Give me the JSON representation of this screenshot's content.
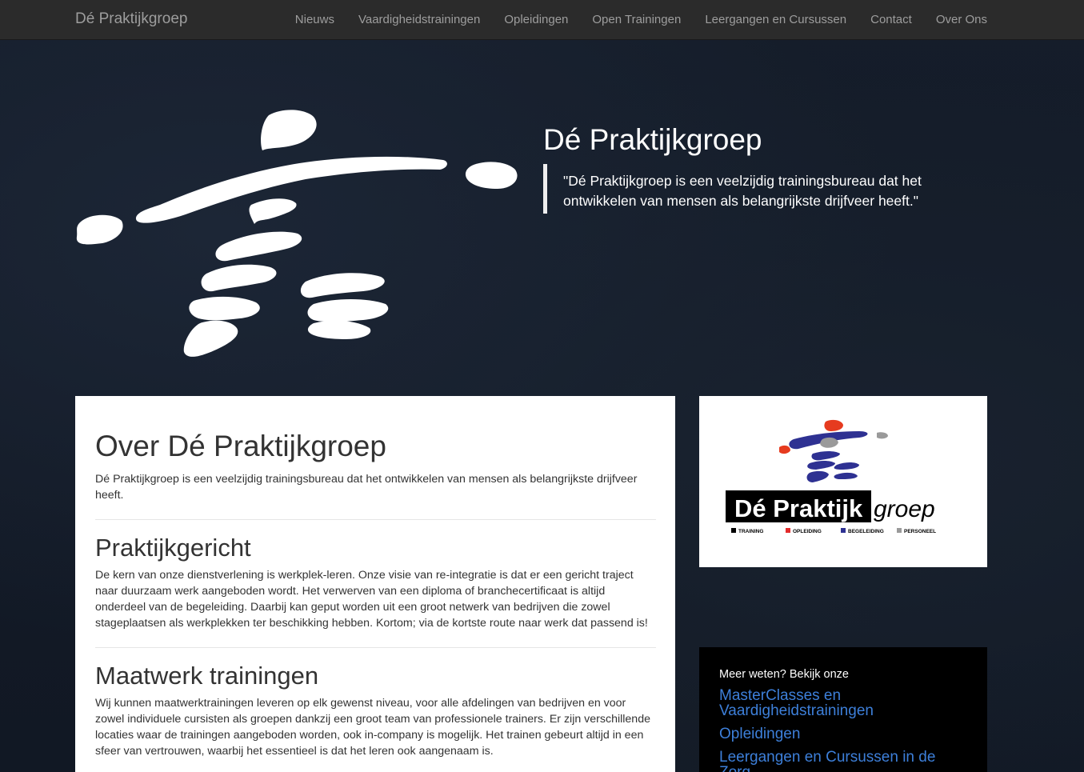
{
  "navbar": {
    "brand": "Dé Praktijkgroep",
    "items": [
      "Nieuws",
      "Vaardigheidstrainingen",
      "Opleidingen",
      "Open Trainingen",
      "Leergangen en Cursussen",
      "Contact",
      "Over Ons"
    ]
  },
  "hero": {
    "title": "Dé Praktijkgroep",
    "quote": "\"Dé Praktijkgroep is een veelzijdig trainingsbureau dat het ontwikkelen van mensen als belangrijkste drijfveer heeft.\""
  },
  "main": {
    "title": "Over Dé Praktijkgroep",
    "intro": "Dé Praktijkgroep is een veelzijdig trainingsbureau dat het ontwikkelen van mensen als belangrijkste drijfveer heeft.",
    "sections": [
      {
        "heading": "Praktijkgericht",
        "text": "De kern van onze dienstverlening is werkplek-leren. Onze visie van re-integratie is dat er een gericht traject naar duurzaam werk aangeboden wordt. Het verwerven van een diploma of branchecertificaat is altijd onderdeel van de begeleiding. Daarbij kan geput worden uit een groot netwerk van bedrijven die zowel stageplaatsen als werkplekken ter beschikking hebben. Kortom; via de kortste route naar werk dat passend is!"
      },
      {
        "heading": "Maatwerk trainingen",
        "text": "Wij kunnen maatwerktrainingen leveren op elk gewenst niveau, voor alle afdelingen van bedrijven en voor zowel individuele cursisten als groepen dankzij een groot team van professionele trainers. Er zijn verschillende locaties waar de trainingen aangeboden worden, ook in-company is mogelijk. Het trainen gebeurt altijd in een sfeer van vertrouwen, waarbij het essentieel is dat het leren ook aangenaam is."
      }
    ]
  },
  "sidebar": {
    "logo": {
      "wordmark_bold": "Dé Praktijk",
      "wordmark_italic": "groep",
      "tags": [
        "TRAINING",
        "OPLEIDING",
        "BEGELEIDING",
        "PERSONEEL"
      ],
      "tag_colors": [
        "#000000",
        "#e32b2b",
        "#2e3192",
        "#9a9a9a"
      ]
    },
    "links": {
      "lead": "Meer weten? Bekijk onze",
      "items": [
        "MasterClasses en Vaardigheidstrainingen",
        "Opleidingen",
        "Leergangen en Cursussen in de Zorg"
      ]
    }
  }
}
